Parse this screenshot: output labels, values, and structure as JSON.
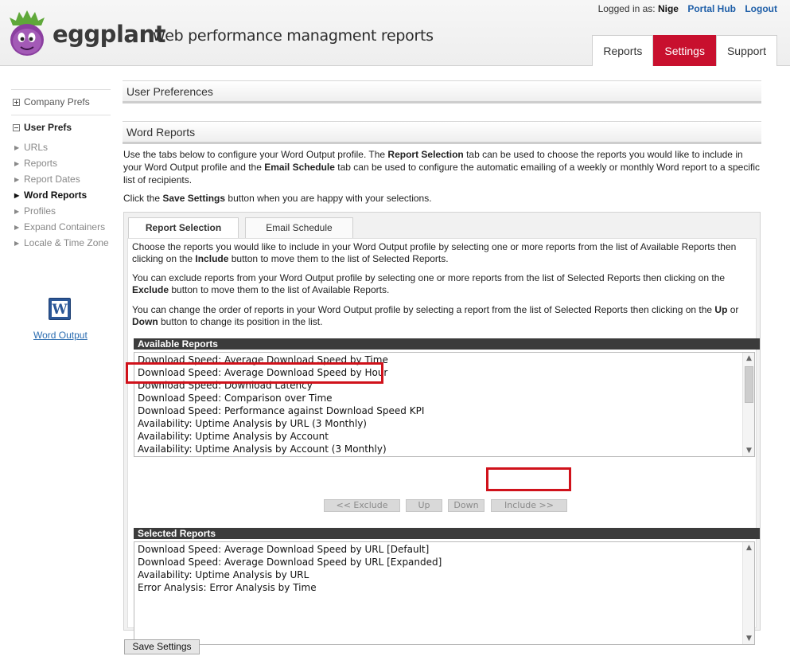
{
  "header": {
    "brand": "eggplant",
    "tagline": "web performance managment reports",
    "logged_in_label": "Logged in as:",
    "username": "Nige",
    "links": [
      "Portal Hub",
      "Logout"
    ],
    "nav_tabs": [
      {
        "label": "Reports",
        "active": false
      },
      {
        "label": "Settings",
        "active": true
      },
      {
        "label": "Support",
        "active": false
      }
    ],
    "accent_color": "#c8102e"
  },
  "sidebar": {
    "company_prefs": "Company Prefs",
    "user_prefs": "User Prefs",
    "items": [
      "URLs",
      "Reports",
      "Report Dates",
      "Word Reports",
      "Profiles",
      "Expand Containers",
      "Locale & Time Zone"
    ],
    "active_item": "Word Reports",
    "word_icon_letter": "W",
    "word_output_link": "Word Output"
  },
  "main": {
    "user_prefs_title": "User Preferences",
    "word_reports_title": "Word Reports",
    "intro": {
      "p1_a": "Use the tabs below to configure your Word Output profile. The ",
      "p1_b": "Report Selection",
      "p1_c": " tab can be used to choose the reports you would like to include in your Word Output profile and the ",
      "p1_d": "Email Schedule",
      "p1_e": " tab can be used to configure the automatic emailing of a weekly or monthly Word report to a specific list of recipients.",
      "p2_a": "Click the ",
      "p2_b": "Save Settings",
      "p2_c": " button when you are happy with your selections."
    },
    "tabs": [
      {
        "label": "Report Selection",
        "active": true
      },
      {
        "label": "Email Schedule",
        "active": false
      }
    ],
    "panel_text": {
      "p1_a": "Choose the reports you would like to include in your Word Output profile by selecting one or more reports from the list of Available Reports then clicking on the ",
      "p1_b": "Include",
      "p1_c": " button to move them to the list of Selected Reports.",
      "p2_a": "You can exclude reports from your Word Output profile by selecting one or more reports from the list of Selected Reports then clicking on the ",
      "p2_b": "Exclude",
      "p2_c": " button to move them to the list of Available Reports.",
      "p3_a": "You can change the order of reports in your Word Output profile by selecting a report from the list of Selected Reports then clicking on the ",
      "p3_b": "Up",
      "p3_c": " or ",
      "p3_d": "Down",
      "p3_e": " button to change its position in the list."
    },
    "available_reports_header": "Available Reports",
    "available_reports": [
      "Download Speed: Average Download Speed by Time",
      "Download Speed: Average Download Speed by Hour",
      "Download Speed: Download Latency",
      "Download Speed: Comparison over Time",
      "Download Speed: Performance against Download Speed KPI",
      "Availability: Uptime Analysis by URL (3 Monthly)",
      "Availability: Uptime Analysis by Account",
      "Availability: Uptime Analysis by Account (3 Monthly)"
    ],
    "highlighted_report": "Download Speed: Average Download Speed by Hour",
    "buttons": {
      "exclude": "<< Exclude",
      "up": "Up",
      "down": "Down",
      "include": "Include >>"
    },
    "selected_reports_header": "Selected Reports",
    "selected_reports": [
      "Download Speed: Average Download Speed by URL [Default]",
      "Download Speed: Average Download Speed by URL [Expanded]",
      "Availability: Uptime Analysis by URL",
      "Error Analysis: Error Analysis by Time"
    ],
    "save_button": "Save Settings",
    "highlight_color": "#d0121b"
  }
}
